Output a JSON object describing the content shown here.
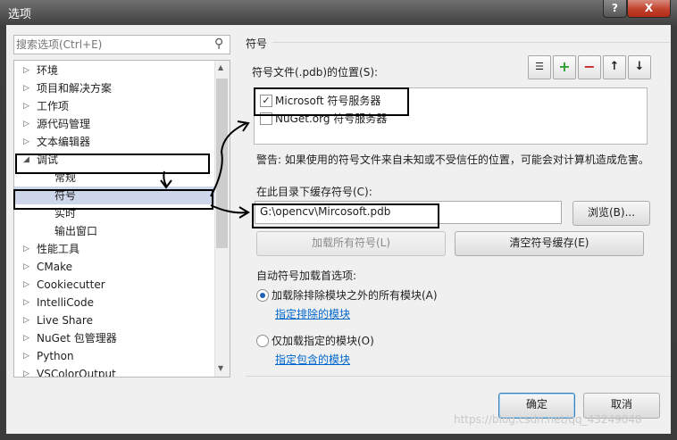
{
  "window": {
    "title": "选项",
    "help_label": "?",
    "close_label": "X"
  },
  "search": {
    "placeholder": "搜索选项(Ctrl+E)",
    "icon": "search-icon"
  },
  "tree": {
    "items": [
      {
        "label": "环境",
        "level": 0,
        "expanded": false
      },
      {
        "label": "项目和解决方案",
        "level": 0,
        "expanded": false
      },
      {
        "label": "工作项",
        "level": 0,
        "expanded": false
      },
      {
        "label": "源代码管理",
        "level": 0,
        "expanded": false
      },
      {
        "label": "文本编辑器",
        "level": 0,
        "expanded": false
      },
      {
        "label": "调试",
        "level": 0,
        "expanded": true
      },
      {
        "label": "常规",
        "level": 1
      },
      {
        "label": "符号",
        "level": 1,
        "selected": true
      },
      {
        "label": "实时",
        "level": 1
      },
      {
        "label": "输出窗口",
        "level": 1
      },
      {
        "label": "性能工具",
        "level": 0,
        "expanded": false
      },
      {
        "label": "CMake",
        "level": 0,
        "expanded": false
      },
      {
        "label": "Cookiecutter",
        "level": 0,
        "expanded": false
      },
      {
        "label": "IntelliCode",
        "level": 0,
        "expanded": false
      },
      {
        "label": "Live Share",
        "level": 0,
        "expanded": false
      },
      {
        "label": "NuGet 包管理器",
        "level": 0,
        "expanded": false
      },
      {
        "label": "Python",
        "level": 0,
        "expanded": false
      },
      {
        "label": "VSColorOutput",
        "level": 0,
        "expanded": false
      }
    ]
  },
  "panel": {
    "title": "符号",
    "symbol_locations_label": "符号文件(.pdb)的位置(S):",
    "toolbar": {
      "add_label": "+",
      "remove_label": "−",
      "up_label": "↑",
      "down_label": "↓"
    },
    "symbol_servers": [
      {
        "label": "Microsoft 符号服务器",
        "checked": true
      },
      {
        "label": "NuGet.org 符号服务器",
        "checked": false
      }
    ],
    "warning": "警告: 如果使用的符号文件来自未知或不受信任的位置，可能会对计算机造成危害。",
    "cache_label": "在此目录下缓存符号(C):",
    "cache_value": "G:\\opencv\\Mircosoft.pdb",
    "browse_label": "浏览(B)...",
    "load_all_label": "加载所有符号(L)",
    "clear_cache_label": "清空符号缓存(E)",
    "auto_load_label": "自动符号加载首选项:",
    "radio_all": {
      "label": "加载除排除模块之外的所有模块(A)",
      "selected": true
    },
    "link_excluded": "指定排除的模块",
    "radio_specified": {
      "label": "仅加载指定的模块(O)",
      "selected": false
    },
    "link_included": "指定包含的模块"
  },
  "footer": {
    "ok_label": "确定",
    "cancel_label": "取消"
  },
  "watermark": "https://blog.csdn.net/qq_43249048",
  "colors": {
    "selection": "#cdd6ea",
    "link": "#0066cc",
    "add_green": "#2f9e2f",
    "remove_red": "#c62828"
  }
}
